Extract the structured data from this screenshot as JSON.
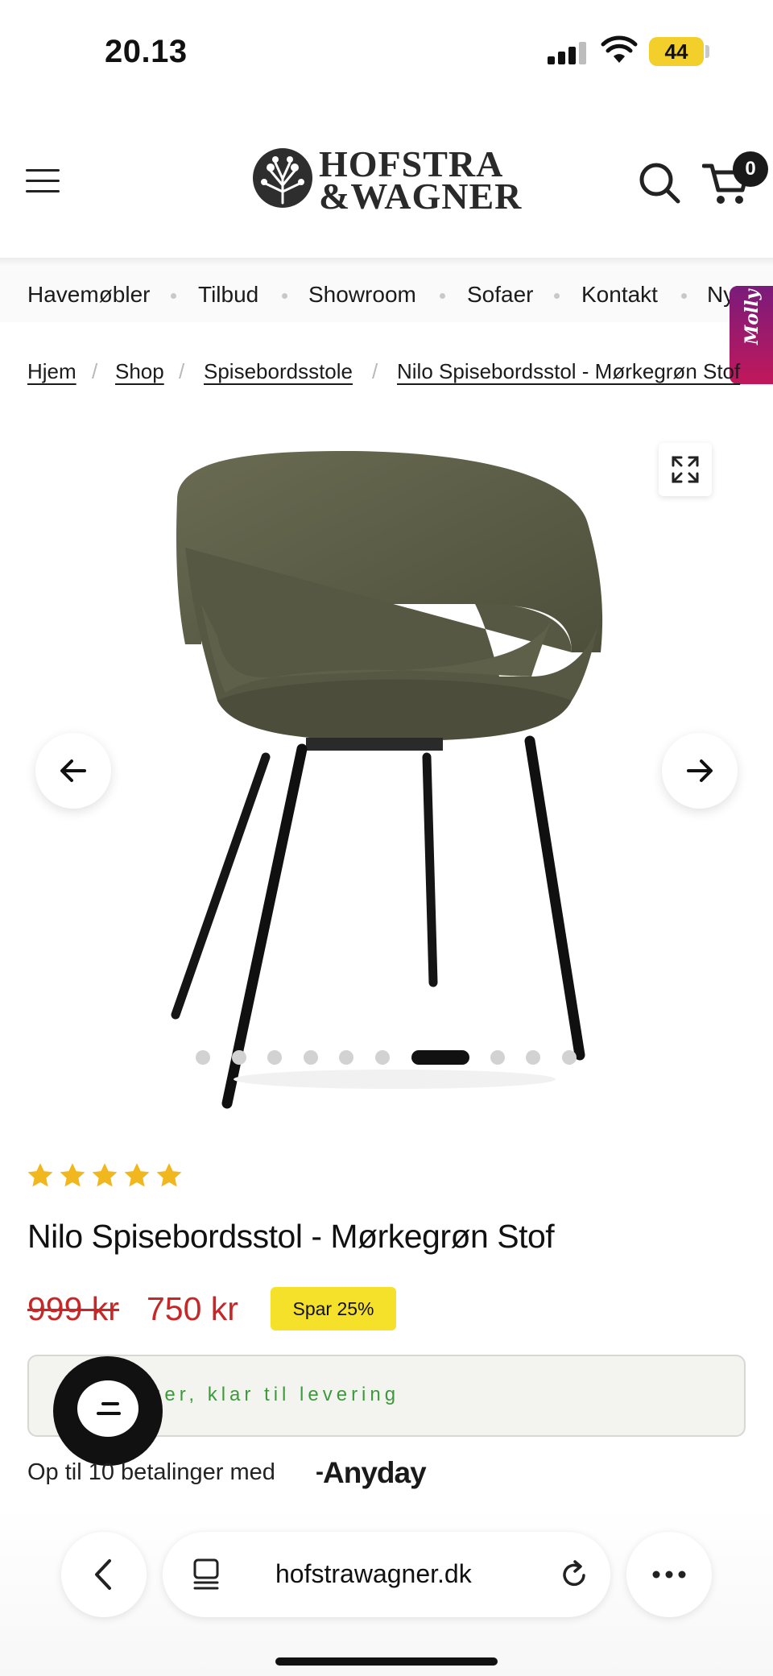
{
  "status_bar": {
    "time": "20.13",
    "battery": "44"
  },
  "header": {
    "logo_text_line1": "HOFSTRA",
    "logo_text_line2": "&WAGNER",
    "cart_count": "0"
  },
  "category_nav": {
    "items": [
      "Havemøbler",
      "Tilbud",
      "Showroom",
      "Sofaer",
      "Kontakt",
      "Nyh"
    ]
  },
  "molly_tab": {
    "label": "Molly"
  },
  "breadcrumb": {
    "items": [
      "Hjem",
      "Shop",
      "Spisebordsstole",
      "Nilo Spisebordsstol - Mørkegrøn Stof"
    ]
  },
  "gallery": {
    "dot_count": 10,
    "active_index": 6
  },
  "product": {
    "rating": 5,
    "title": "Nilo Spisebordsstol - Mørkegrøn Stof",
    "price_old": "999 kr",
    "price_new": "750 kr",
    "save_badge": "Spar 25%",
    "stock_text": "ger, klar til levering",
    "payment_text": "Op til 10 betalinger med",
    "payment_brand": "Anyday"
  },
  "browser": {
    "url": "hofstrawagner.dk"
  },
  "colors": {
    "sale_red": "#c62828",
    "badge_yellow": "#f5e12a",
    "star_gold": "#f0b71f",
    "stock_green": "#3c9a3c",
    "chair_fabric": "#5b5c45"
  }
}
